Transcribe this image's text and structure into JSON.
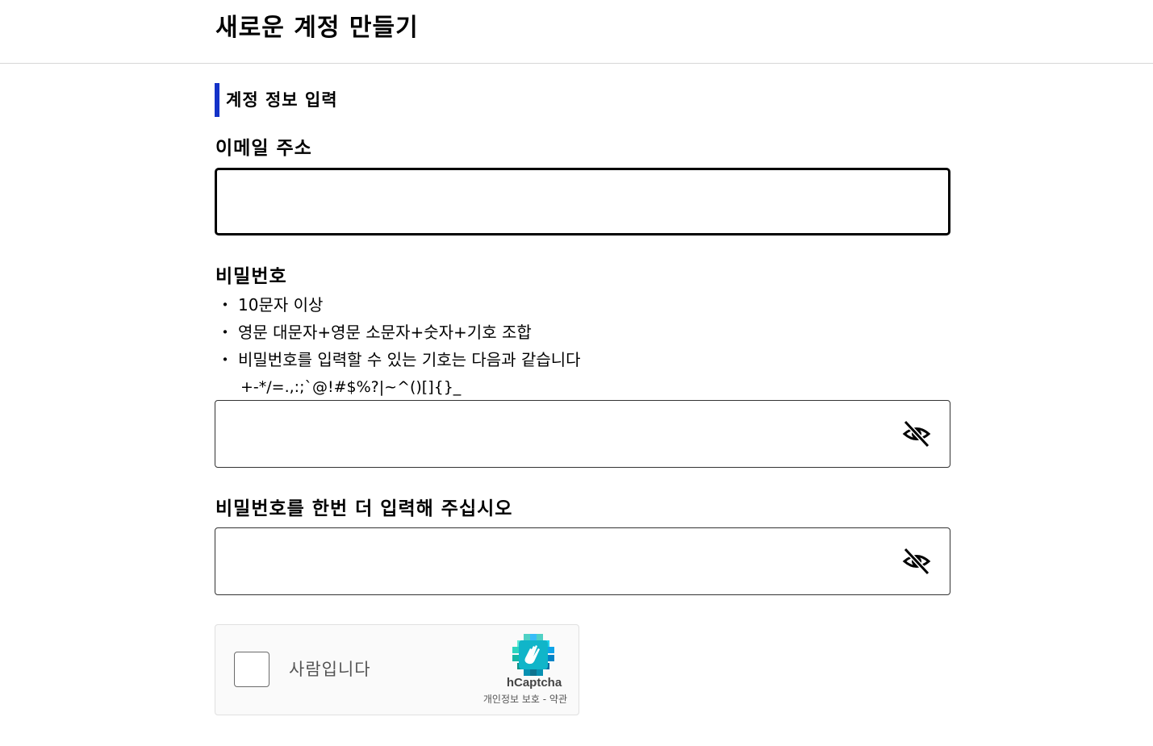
{
  "header": {
    "title": "새로운 계정 만들기"
  },
  "section": {
    "heading": "계정 정보 입력",
    "accent_color": "#1432c8"
  },
  "email": {
    "label": "이메일 주소",
    "value": "",
    "placeholder": ""
  },
  "password": {
    "label": "비밀번호",
    "rules": [
      "10문자 이상",
      "영문 대문자+영문 소문자+숫자+기호 조합",
      "비밀번호를 입력할 수 있는 기호는 다음과 같습니다"
    ],
    "bullet": "・",
    "allowed_symbols": "+-*/=.,:;`@!#$%?|~^()[]{}_",
    "value": "",
    "toggle_icon": "eye-off-icon"
  },
  "password_confirm": {
    "label": "비밀번호를 한번 더 입력해 주십시오",
    "value": "",
    "toggle_icon": "eye-off-icon"
  },
  "captcha": {
    "label": "사람입니다",
    "brand": "hCaptcha",
    "privacy_link": "개인정보 보호",
    "separator": " - ",
    "terms_link": "약관",
    "checked": false
  }
}
